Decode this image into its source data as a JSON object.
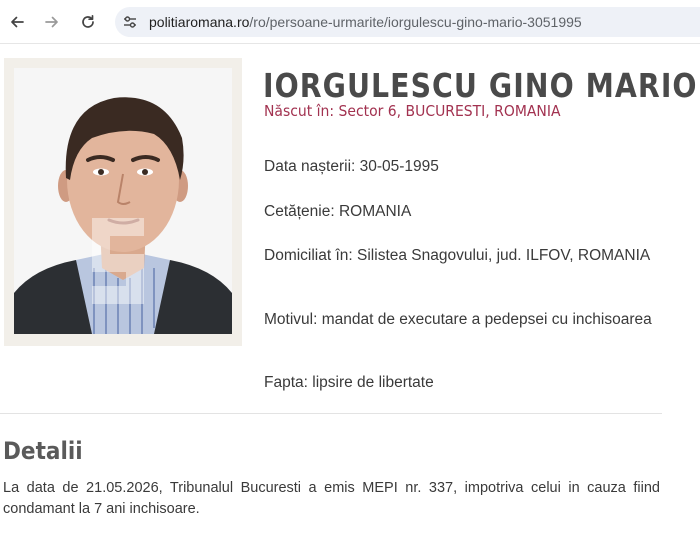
{
  "browser": {
    "url_domain": "politiaromana.ro",
    "url_path": "/ro/persoane-urmarite/iorgulescu-gino-mario-3051995"
  },
  "person": {
    "name": "IORGULESCU GINO MARIO",
    "born": "Născut în: Sector 6, BUCURESTI, ROMANIA",
    "birth_date": "Data nașterii: 30-05-1995",
    "citizenship": "Cetățenie: ROMANIA",
    "domicile": "Domiciliat în: Silistea Snagovului, jud. ILFOV, ROMANIA",
    "reason": "Motivul: mandat de executare a pedepsei cu inchisoarea",
    "offense": "Fapta: lipsire de libertate"
  },
  "details": {
    "title": "Detalii",
    "text": "La data de 21.05.2026, Tribunalul Bucuresti a emis MEPI nr. 337, impotriva celui in cauza fiind condamant la 7 ani inchisoare."
  },
  "icons": {
    "back": "arrow-left-icon",
    "forward": "arrow-right-icon",
    "reload": "reload-icon",
    "site_info": "tune-icon"
  },
  "colors": {
    "accent": "#a23250",
    "name": "#4a4a4a",
    "omnibox": "#eef1f7"
  }
}
